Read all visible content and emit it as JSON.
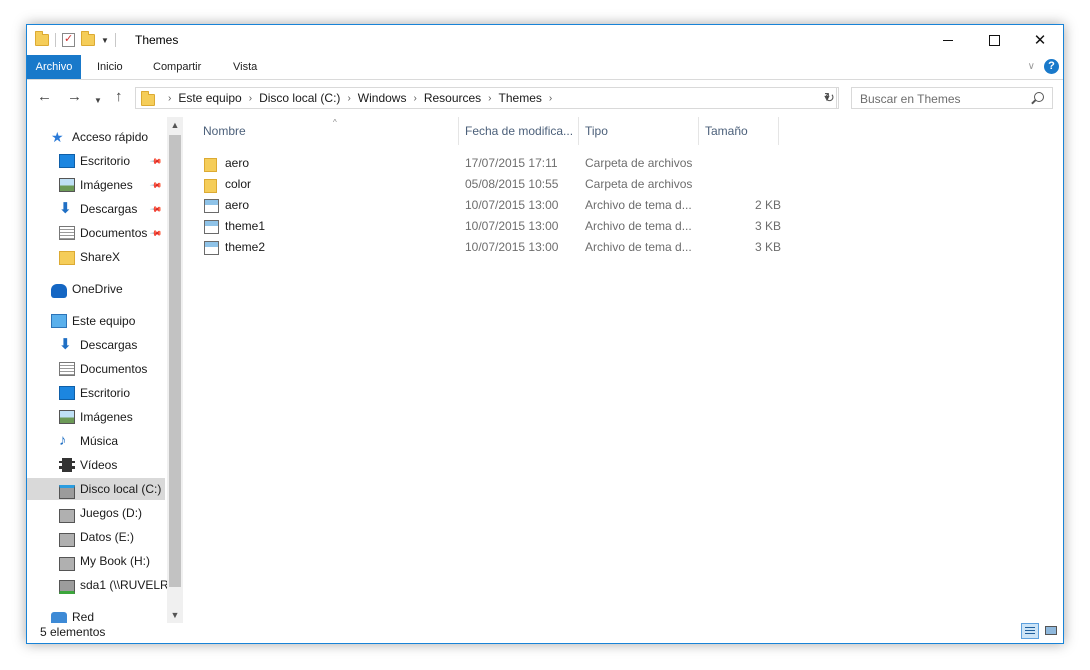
{
  "window": {
    "title": "Themes"
  },
  "ribbon": {
    "tabs": [
      "Archivo",
      "Inicio",
      "Compartir",
      "Vista"
    ]
  },
  "address": {
    "crumbs": [
      "Este equipo",
      "Disco local (C:)",
      "Windows",
      "Resources",
      "Themes"
    ]
  },
  "search": {
    "placeholder": "Buscar en Themes"
  },
  "nav": {
    "items": [
      {
        "label": "Acceso rápido",
        "icon": "star-icon",
        "indent": false,
        "pinned": false,
        "selected": false
      },
      {
        "label": "Escritorio",
        "icon": "desktop-icon",
        "indent": true,
        "pinned": true,
        "selected": false
      },
      {
        "label": "Imágenes",
        "icon": "pictures-icon",
        "indent": true,
        "pinned": true,
        "selected": false
      },
      {
        "label": "Descargas",
        "icon": "downloads-icon",
        "indent": true,
        "pinned": true,
        "selected": false
      },
      {
        "label": "Documentos",
        "icon": "documents-icon",
        "indent": true,
        "pinned": true,
        "selected": false
      },
      {
        "label": "ShareX",
        "icon": "folder-icon",
        "indent": true,
        "pinned": false,
        "selected": false
      },
      {
        "label": "OneDrive",
        "icon": "onedrive-icon",
        "indent": false,
        "pinned": false,
        "selected": false
      },
      {
        "label": "Este equipo",
        "icon": "computer-icon",
        "indent": false,
        "pinned": false,
        "selected": false
      },
      {
        "label": "Descargas",
        "icon": "downloads-icon",
        "indent": true,
        "pinned": false,
        "selected": false
      },
      {
        "label": "Documentos",
        "icon": "documents-icon",
        "indent": true,
        "pinned": false,
        "selected": false
      },
      {
        "label": "Escritorio",
        "icon": "desktop-icon",
        "indent": true,
        "pinned": false,
        "selected": false
      },
      {
        "label": "Imágenes",
        "icon": "pictures-icon",
        "indent": true,
        "pinned": false,
        "selected": false
      },
      {
        "label": "Música",
        "icon": "music-icon",
        "indent": true,
        "pinned": false,
        "selected": false
      },
      {
        "label": "Vídeos",
        "icon": "videos-icon",
        "indent": true,
        "pinned": false,
        "selected": false
      },
      {
        "label": "Disco local (C:)",
        "icon": "system-drive-icon",
        "indent": true,
        "pinned": false,
        "selected": true
      },
      {
        "label": "Juegos (D:)",
        "icon": "drive-icon",
        "indent": true,
        "pinned": false,
        "selected": false
      },
      {
        "label": "Datos (E:)",
        "icon": "drive-icon",
        "indent": true,
        "pinned": false,
        "selected": false
      },
      {
        "label": "My Book (H:)",
        "icon": "drive-icon",
        "indent": true,
        "pinned": false,
        "selected": false
      },
      {
        "label": "sda1 (\\\\RUVELRO",
        "icon": "network-drive-icon",
        "indent": true,
        "pinned": false,
        "selected": false
      },
      {
        "label": "Red",
        "icon": "network-icon",
        "indent": false,
        "pinned": false,
        "selected": false
      }
    ]
  },
  "list": {
    "columns": [
      "Nombre",
      "Fecha de modifica...",
      "Tipo",
      "Tamaño"
    ],
    "rows": [
      {
        "name": "aero",
        "date": "17/07/2015 17:11",
        "type": "Carpeta de archivos",
        "size": "",
        "icon": "folder-icon"
      },
      {
        "name": "color",
        "date": "05/08/2015 10:55",
        "type": "Carpeta de archivos",
        "size": "",
        "icon": "folder-icon"
      },
      {
        "name": "aero",
        "date": "10/07/2015 13:00",
        "type": "Archivo de tema d...",
        "size": "2 KB",
        "icon": "theme-file-icon"
      },
      {
        "name": "theme1",
        "date": "10/07/2015 13:00",
        "type": "Archivo de tema d...",
        "size": "3 KB",
        "icon": "theme-file-icon"
      },
      {
        "name": "theme2",
        "date": "10/07/2015 13:00",
        "type": "Archivo de tema d...",
        "size": "3 KB",
        "icon": "theme-file-icon"
      }
    ]
  },
  "status": {
    "count": "5 elementos"
  },
  "colors": {
    "accent": "#1979ca",
    "border": "#1883d7",
    "selected": "#d9d9d9"
  }
}
